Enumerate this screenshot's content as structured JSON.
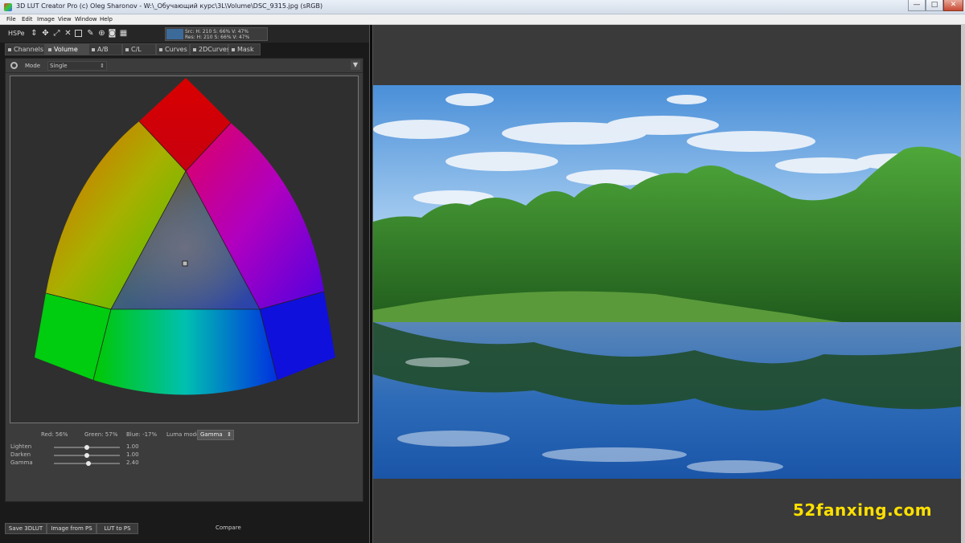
{
  "window": {
    "title": "3D LUT Creator Pro (c) Oleg Sharonov - W:\\_Обучающий курс\\3L\\Volume\\DSC_9315.jpg (sRGB)",
    "min_glyph": "—",
    "max_glyph": "□",
    "close_glyph": "✕"
  },
  "menu": [
    "File",
    "Edit",
    "Image",
    "View",
    "Window",
    "Help"
  ],
  "toolbar": {
    "color_space": "HSPe",
    "icons": [
      "updown-arrows-icon",
      "move-icon",
      "expand-icon",
      "collapse-arrows-icon",
      "select-rect-icon",
      "eyedropper-icon",
      "zoom-icon",
      "camera-icon",
      "grid-icon"
    ],
    "readout": {
      "src_line": "Src: H: 210  S: 66%  V: 47%",
      "res_line": "Res: H: 210  S: 66%  V: 47%",
      "swatch_color": "#3c6a99"
    }
  },
  "tabs": [
    {
      "label": "Channels",
      "active": false
    },
    {
      "label": "Volume",
      "active": true
    },
    {
      "label": "A/B",
      "active": false
    },
    {
      "label": "C/L",
      "active": false
    },
    {
      "label": "Curves",
      "active": false
    },
    {
      "label": "2DCurves",
      "active": false
    },
    {
      "label": "Mask",
      "active": false
    }
  ],
  "mode": {
    "label": "Mode",
    "value": "Single"
  },
  "stats": {
    "red": "Red:  56%",
    "green": "Green: 57%",
    "blue": "Blue: -17%",
    "luma_label": "Luma mode",
    "luma_value": "Gamma"
  },
  "sliders": [
    {
      "label": "Lighten",
      "value": "1.00",
      "position": 0.5
    },
    {
      "label": "Darken",
      "value": "1.00",
      "position": 0.5
    },
    {
      "label": "Gamma",
      "value": "2.40",
      "position": 0.53
    }
  ],
  "bottom": {
    "buttons": [
      "Save 3DLUT",
      "Image from PS",
      "LUT to PS"
    ],
    "compare": "Compare"
  },
  "watermark": "52fanxing.com"
}
